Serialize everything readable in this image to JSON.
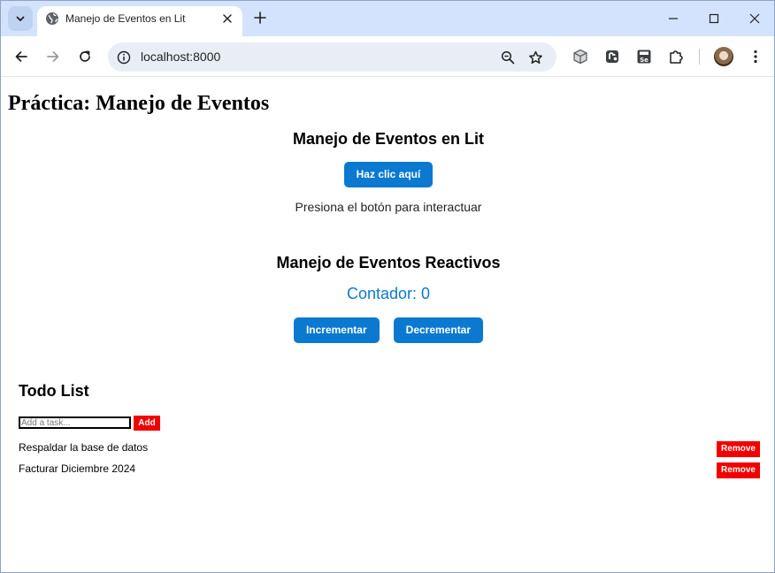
{
  "browser": {
    "tab_title": "Manejo de Eventos en Lit",
    "url": "localhost:8000",
    "tab_menu_icon": "chevron-down-icon",
    "new_tab_icon": "plus-icon",
    "extensions": [
      "3d-box-icon",
      "puzzle-variant-icon",
      "selenium-icon",
      "extensions-icon"
    ]
  },
  "page": {
    "title": "Práctica: Manejo de Eventos",
    "events_section": {
      "heading": "Manejo de Eventos en Lit",
      "button_label": "Haz clic aquí",
      "message": "Presiona el botón para interactuar"
    },
    "reactive_section": {
      "heading": "Manejo de Eventos Reactivos",
      "counter_text": "Contador: 0",
      "increment_label": "Incrementar",
      "decrement_label": "Decrementar"
    },
    "todo": {
      "heading": "Todo List",
      "input_placeholder": "Add a task...",
      "add_label": "Add",
      "remove_label": "Remove",
      "items": [
        {
          "text": "Respaldar la base de datos"
        },
        {
          "text": "Facturar Diciembre 2024"
        }
      ]
    }
  },
  "colors": {
    "accent_blue": "#0b79d0",
    "danger_red": "#f20000",
    "tabbar": "#d3e3fd"
  }
}
